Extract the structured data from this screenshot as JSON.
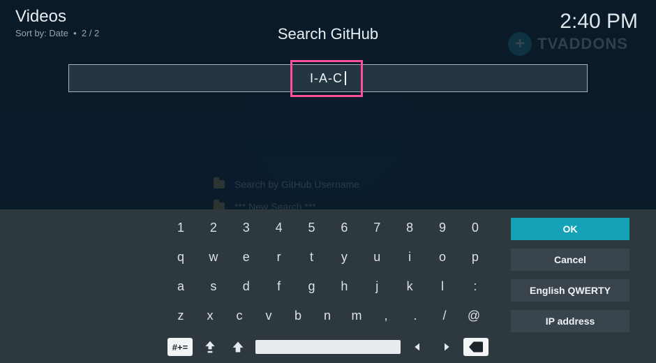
{
  "header": {
    "title": "Videos",
    "sort_label": "Sort by: Date",
    "page_count": "2 / 2"
  },
  "clock": "2:40 PM",
  "dialog": {
    "title": "Search GitHub",
    "input_value": "I-A-C"
  },
  "brand": "TVADDONS",
  "bg_menu": {
    "item1": "Search by GitHub Username",
    "item2": "*** New Search ***"
  },
  "keyboard": {
    "rows": [
      [
        "1",
        "2",
        "3",
        "4",
        "5",
        "6",
        "7",
        "8",
        "9",
        "0"
      ],
      [
        "q",
        "w",
        "e",
        "r",
        "t",
        "y",
        "u",
        "i",
        "o",
        "p"
      ],
      [
        "a",
        "s",
        "d",
        "f",
        "g",
        "h",
        "j",
        "k",
        "l",
        ":"
      ],
      [
        "z",
        "x",
        "c",
        "v",
        "b",
        "n",
        "m",
        ",",
        ".",
        "/",
        "@"
      ]
    ],
    "sym_label": "#+=",
    "buttons": {
      "ok": "OK",
      "cancel": "Cancel",
      "layout": "English QWERTY",
      "ip": "IP address"
    }
  }
}
